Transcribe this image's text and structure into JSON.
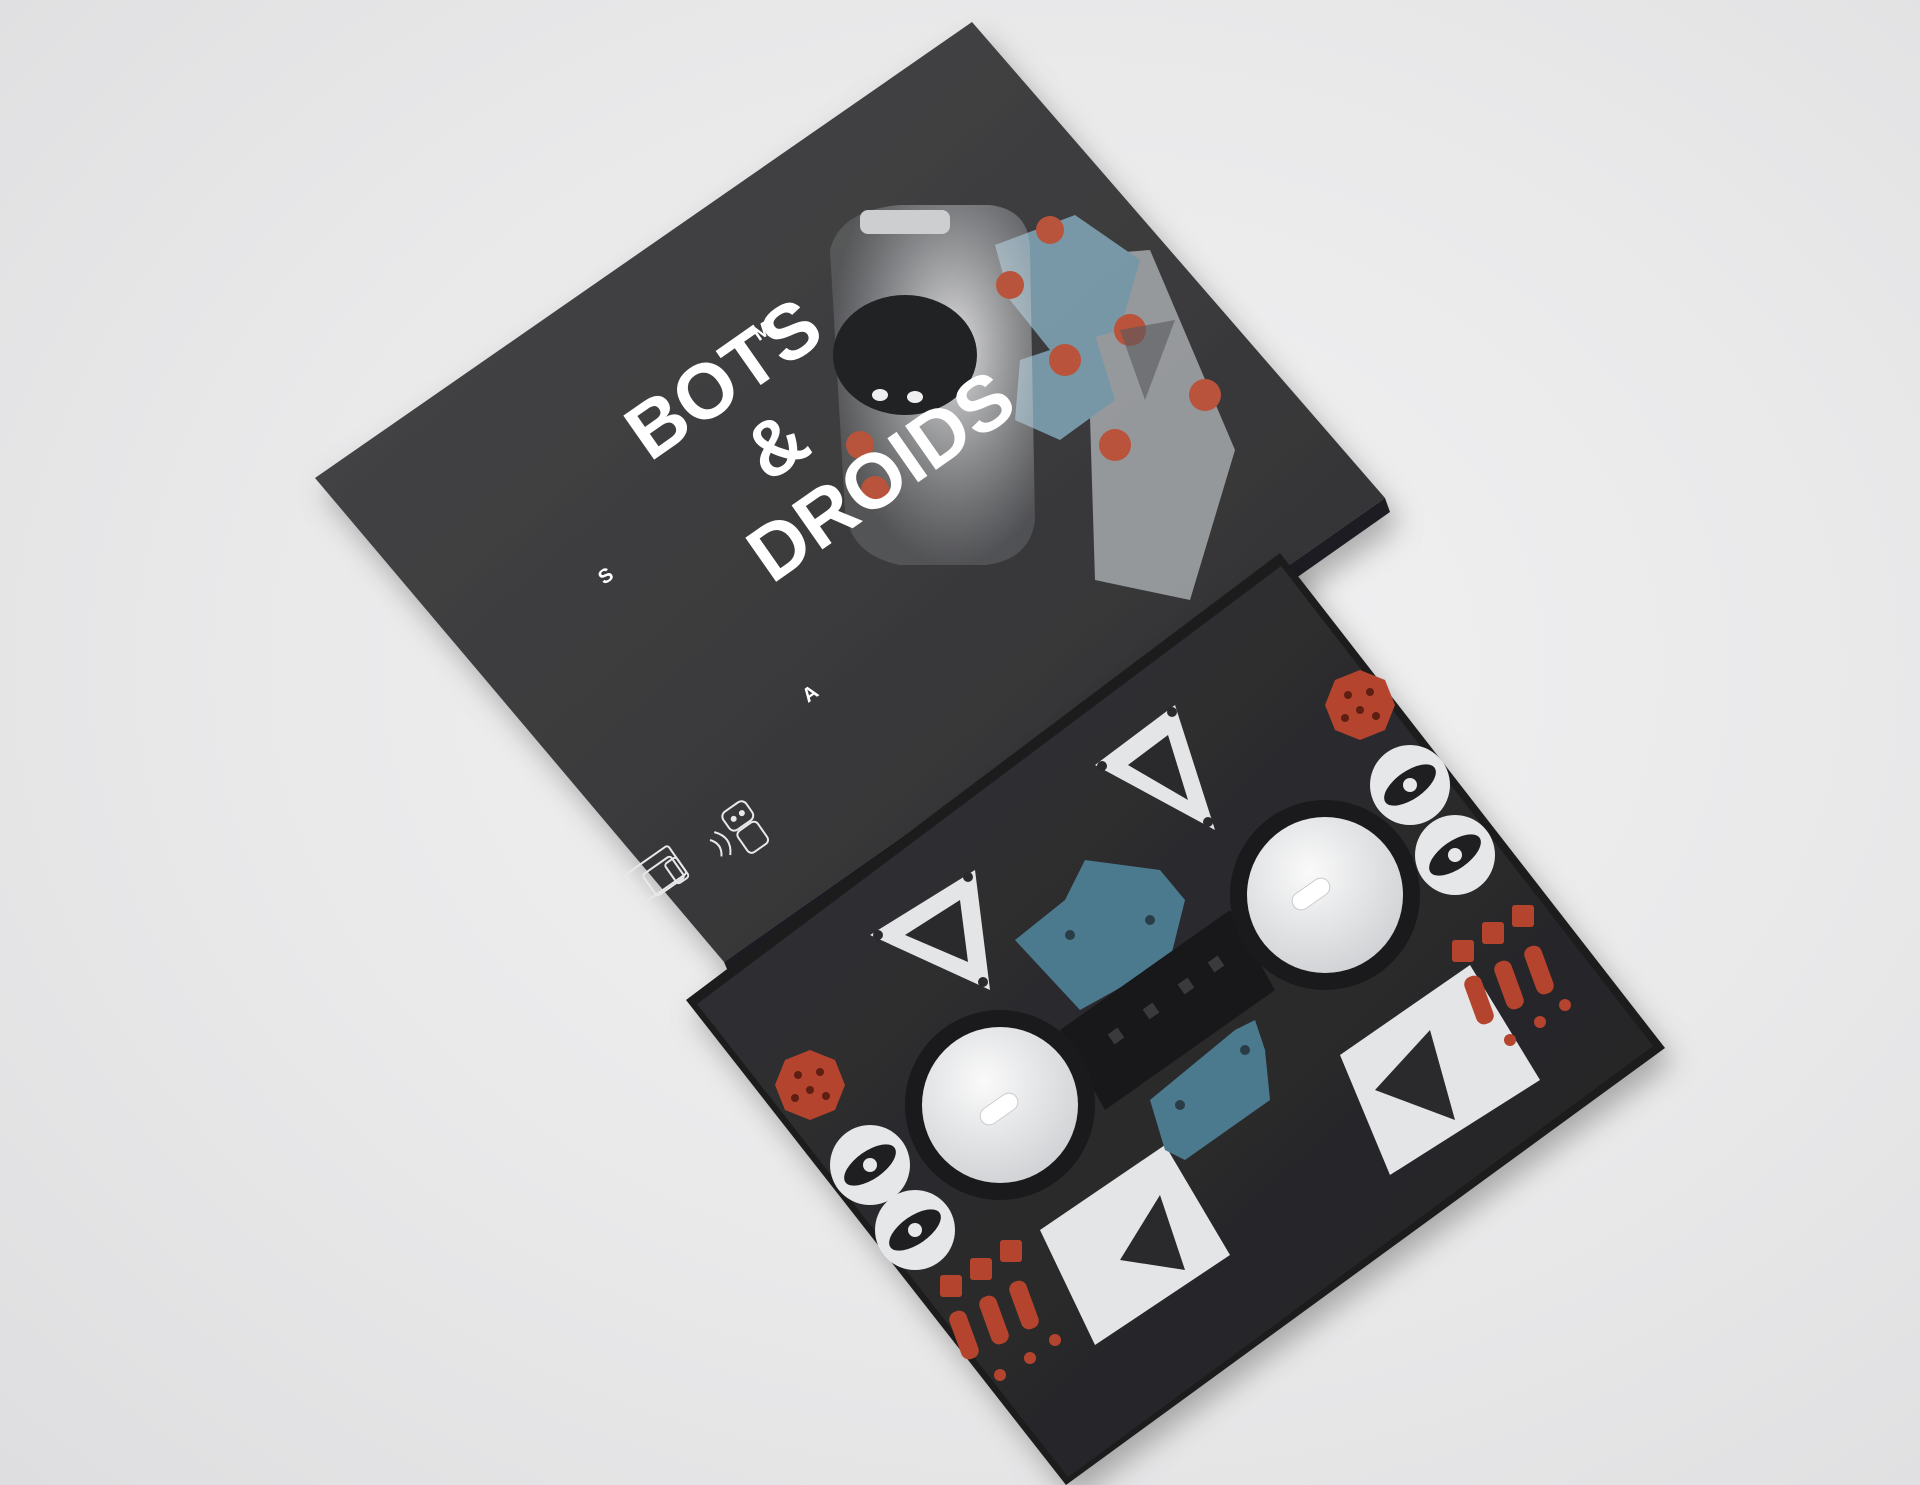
{
  "product": {
    "title_line1": "BOTS",
    "title_line2": "&",
    "title_line3": "DROIDS",
    "corner_letters": {
      "top": "M",
      "left": "S",
      "bottom": "A"
    },
    "icons": [
      "devices-icon",
      "wireless-signal-icon",
      "robot-icon"
    ]
  },
  "colors": {
    "background": "#e9e9ea",
    "lid": "#3a3a3c",
    "tray": "#2b2b2d",
    "accent_orange": "#b4442e",
    "accent_blue": "#4b7a8f",
    "part_white": "#e6e7e9"
  }
}
